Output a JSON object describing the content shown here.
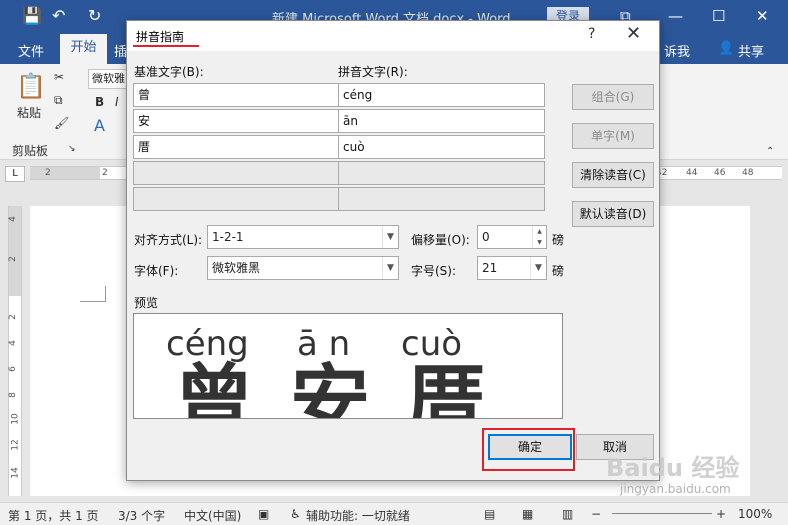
{
  "window": {
    "title": "新建 Microsoft Word 文档.docx  -  Word",
    "login": "登录",
    "minimize": "—",
    "maximize": "☐",
    "close": "✕",
    "restore": "⧉",
    "qat_save": "💾",
    "qat_undo": "↶",
    "qat_redo": "↻"
  },
  "ribbon": {
    "tabs": [
      {
        "label": "文件"
      },
      {
        "label": "开始"
      },
      {
        "label": "插"
      },
      {
        "label": "诉我"
      },
      {
        "label": "共享"
      }
    ],
    "paste_label": "粘贴",
    "clipboard_label": "剪贴板",
    "font_value": "微软雅",
    "bold": "B",
    "italic": "I",
    "font_color": "A"
  },
  "ruler": {
    "tab_btn": "L",
    "left_numbers": [
      "2",
      "2"
    ],
    "right_numbers": [
      "42",
      "44",
      "46",
      "48"
    ],
    "v_numbers": [
      "4",
      "2",
      "2",
      "4",
      "6",
      "8",
      "10",
      "12",
      "14"
    ]
  },
  "dialog": {
    "title": "拼音指南",
    "help": "?",
    "close": "✕",
    "base_label": "基准文字(B):",
    "ruby_label": "拼音文字(R):",
    "rows": [
      {
        "base": "曾",
        "ruby": "céng"
      },
      {
        "base": "安",
        "ruby": "ān"
      },
      {
        "base": "厝",
        "ruby": "cuò"
      },
      {
        "base": "",
        "ruby": ""
      },
      {
        "base": "",
        "ruby": ""
      }
    ],
    "buttons": {
      "group": "组合(G)",
      "mono": "单字(M)",
      "clear": "清除读音(C)",
      "default": "默认读音(D)",
      "ok": "确定",
      "cancel": "取消"
    },
    "align_label": "对齐方式(L):",
    "align_value": "1-2-1",
    "offset_label": "偏移量(O):",
    "offset_value": "0",
    "offset_unit": "磅",
    "font_label": "字体(F):",
    "font_value": "微软雅黑",
    "size_label": "字号(S):",
    "size_value": "21",
    "size_unit": "磅",
    "preview_label": "预览",
    "preview": {
      "pinyin": [
        "céng",
        "ā n",
        "cuò"
      ],
      "chars": [
        "曾",
        "安",
        "厝"
      ]
    }
  },
  "status": {
    "page": "第 1 页，共 1 页",
    "words": "3/3 个字",
    "lang": "中文(中国)",
    "accessibility": "辅助功能: 一切就绪",
    "zoom": "100%",
    "minus": "−",
    "plus": "+"
  },
  "watermark": {
    "brand": "Baidu 经验",
    "url": "jingyan.baidu.com"
  },
  "colors": {
    "titlebar": "#2b579a",
    "highlight": "#e0202a",
    "primary_border": "#0078d7"
  }
}
